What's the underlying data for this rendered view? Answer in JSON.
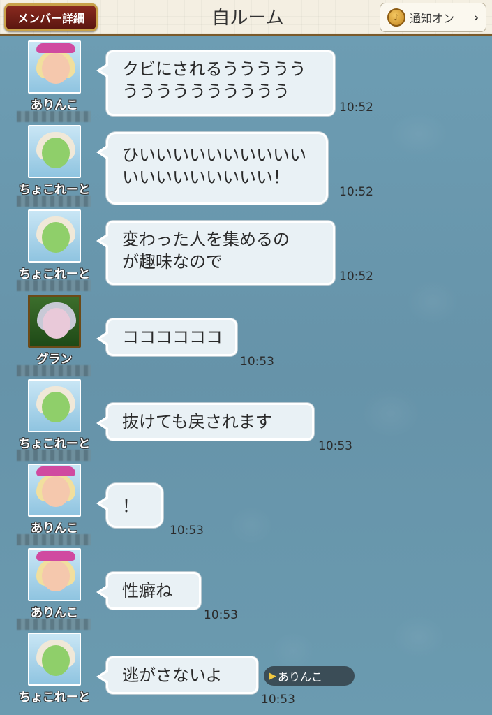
{
  "header": {
    "members_label": "メンバー詳細",
    "title": "自ルーム",
    "notify_label": "通知オン",
    "notify_icon": "bell-icon",
    "chevron": "›"
  },
  "messages": [
    {
      "sender": "ありんこ",
      "text": "クビにされるううううう\nうううううううううう",
      "time": "10:52",
      "avatar": "pink-hair-avatar"
    },
    {
      "sender": "ちょこれーと",
      "text": "ひいいいいいいいいいい\nいいいいいいいいい！",
      "time": "10:52",
      "avatar": "green-avatar"
    },
    {
      "sender": "ちょこれーと",
      "text": "変わった人を集めるの\nが趣味なので",
      "time": "10:52",
      "avatar": "green-avatar"
    },
    {
      "sender": "グラン",
      "text": "ココココココ",
      "time": "10:53",
      "avatar": "elf-avatar"
    },
    {
      "sender": "ちょこれーと",
      "text": "抜けても戻されます",
      "time": "10:53",
      "avatar": "green-avatar"
    },
    {
      "sender": "ありんこ",
      "text": "！",
      "time": "10:53",
      "avatar": "pink-hair-avatar"
    },
    {
      "sender": "ありんこ",
      "text": "性癖ね",
      "time": "10:53",
      "avatar": "pink-hair-avatar"
    },
    {
      "sender": "ちょこれーと",
      "text": "逃がさないよ",
      "time": "10:53",
      "avatar": "green-avatar",
      "mention": "ありんこ"
    }
  ]
}
